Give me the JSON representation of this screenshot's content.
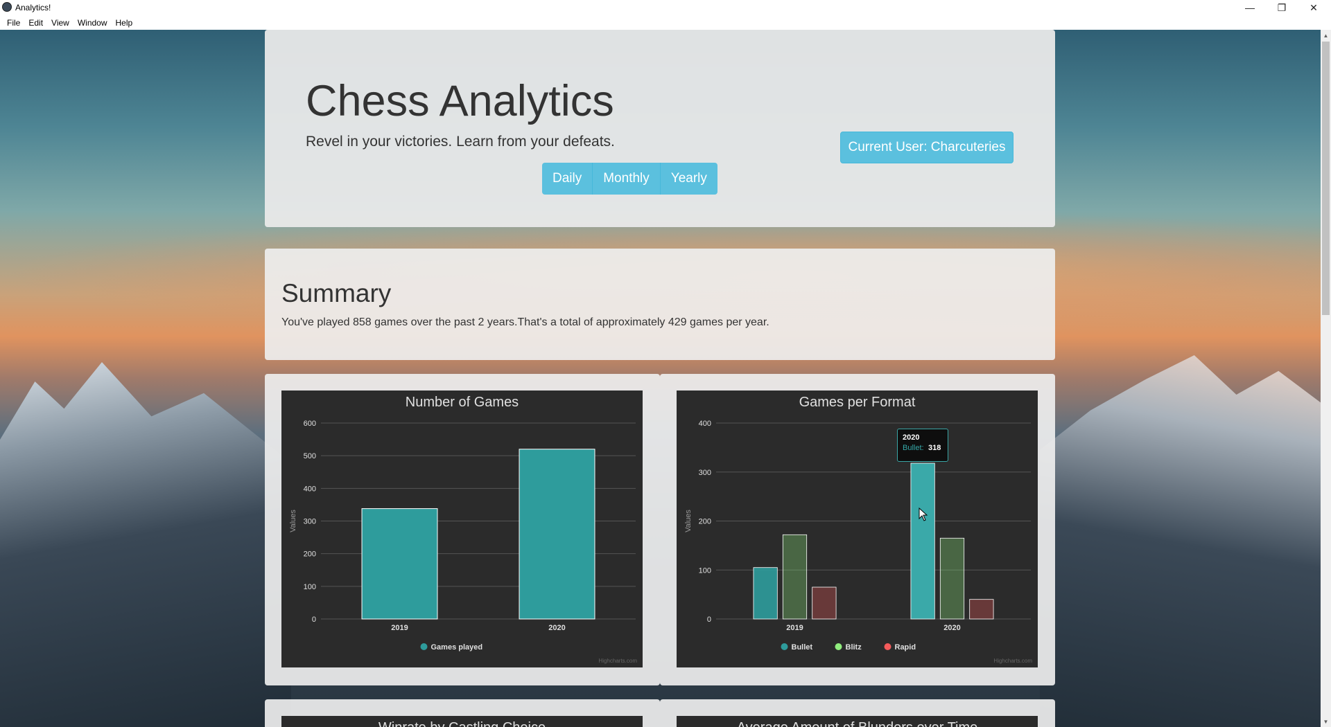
{
  "window": {
    "title": "Analytics!",
    "menu": [
      "File",
      "Edit",
      "View",
      "Window",
      "Help"
    ],
    "minimize_icon": "minimize-icon",
    "maximize_icon": "restore-icon",
    "close_icon": "close-icon"
  },
  "hero": {
    "title": "Chess Analytics",
    "subtitle": "Revel in your victories. Learn from your defeats.",
    "periods": [
      "Daily",
      "Monthly",
      "Yearly"
    ],
    "user_button": "Current User: Charcuteries"
  },
  "summary": {
    "title": "Summary",
    "text": "You've played 858 games over the past 2 years.That's a total of approximately 429 games per year."
  },
  "colors": {
    "accent": "#5bc0de",
    "bullet": "#2e9c9c",
    "blitz": "#90ee7e",
    "rapid": "#f45b5b",
    "chart_bg": "#2b2b2b"
  },
  "chart_data": [
    {
      "type": "bar",
      "title": "Number of Games",
      "ylabel": "Values",
      "categories": [
        "2019",
        "2020"
      ],
      "ylim": [
        0,
        600
      ],
      "yticks": [
        0,
        100,
        200,
        300,
        400,
        500,
        600
      ],
      "series": [
        {
          "name": "Games played",
          "values": [
            338,
            520
          ],
          "color": "#2e9c9c"
        }
      ],
      "credits": "Highcharts.com",
      "legend": "bottom-center"
    },
    {
      "type": "bar",
      "title": "Games per Format",
      "ylabel": "Values",
      "categories": [
        "2019",
        "2020"
      ],
      "ylim": [
        0,
        400
      ],
      "yticks": [
        0,
        100,
        200,
        300,
        400
      ],
      "series": [
        {
          "name": "Bullet",
          "values": [
            105,
            318
          ],
          "color": "#2e9c9c"
        },
        {
          "name": "Blitz",
          "values": [
            172,
            165
          ],
          "color": "#90ee7e"
        },
        {
          "name": "Rapid",
          "values": [
            65,
            40
          ],
          "color": "#f45b5b"
        }
      ],
      "credits": "Highcharts.com",
      "legend": "bottom-center",
      "tooltip": {
        "category": "2020",
        "series": "Bullet",
        "value": "318"
      }
    }
  ],
  "lower_cards": [
    {
      "title": "Winrate by Castling Choice"
    },
    {
      "title": "Average Amount of Blunders over Time"
    }
  ]
}
